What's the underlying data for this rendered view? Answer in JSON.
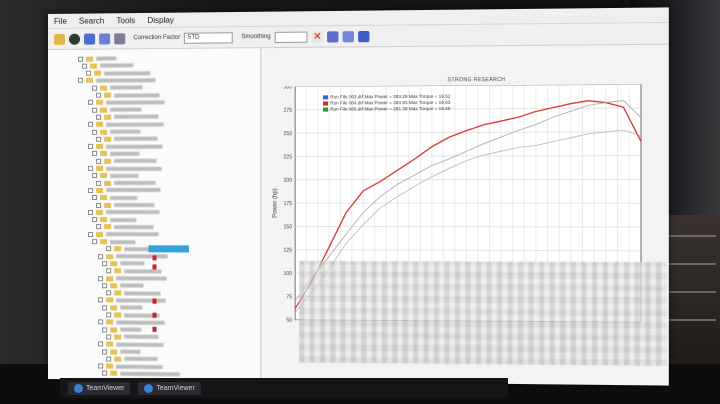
{
  "menubar": {
    "items": [
      "File",
      "Search",
      "Tools",
      "Display"
    ]
  },
  "toolbar": {
    "correction_label": "Correction Factor",
    "correction_value": "STD",
    "smoothing_label": "Smoothing"
  },
  "chart": {
    "header": "STRONG RESEARCH",
    "legend": [
      {
        "text": "Run File 003.drf Max Power = 283.29 Max Torque = 19.52",
        "color": "#3b5bd9"
      },
      {
        "text": "Run File 004.drf Max Power = 283.93 Max Torque = 19.63",
        "color": "#d62b24"
      },
      {
        "text": "Run File 005.drf Max Power = 281.38 Max Torque = 19.65",
        "color": "#2f9a3a"
      }
    ],
    "ylabel": "Power (hp)",
    "yticks": [
      "300",
      "275",
      "250",
      "225",
      "200",
      "175",
      "150",
      "125",
      "100",
      "75",
      "50"
    ]
  },
  "chart_data": {
    "type": "line",
    "title": "",
    "ylabel": "Power (hp)",
    "ylim": [
      50,
      300
    ],
    "x": [
      0,
      1,
      2,
      3,
      4,
      5,
      6,
      7,
      8,
      9,
      10,
      11,
      12,
      13,
      14,
      15,
      16,
      17,
      18,
      19,
      20
    ],
    "series": [
      {
        "name": "Run File 004.drf",
        "color": "#d62b24",
        "values": [
          62,
          92,
          128,
          165,
          188,
          198,
          210,
          222,
          235,
          245,
          252,
          258,
          262,
          266,
          272,
          276,
          280,
          283,
          281,
          276,
          240
        ]
      },
      {
        "name": "Run File 003.drf",
        "color": "#9a9a9a",
        "values": [
          70,
          95,
          118,
          142,
          165,
          182,
          195,
          205,
          215,
          222,
          230,
          238,
          245,
          252,
          258,
          266,
          272,
          278,
          281,
          283,
          265
        ]
      },
      {
        "name": "Run File 005.drf",
        "color": "#b0b0b0",
        "values": [
          58,
          80,
          105,
          132,
          152,
          170,
          182,
          193,
          203,
          212,
          220,
          226,
          230,
          234,
          236,
          240,
          244,
          248,
          250,
          252,
          246
        ]
      }
    ]
  },
  "taskbar": {
    "apps": [
      "TeamViewer",
      "TeamViewer"
    ]
  }
}
